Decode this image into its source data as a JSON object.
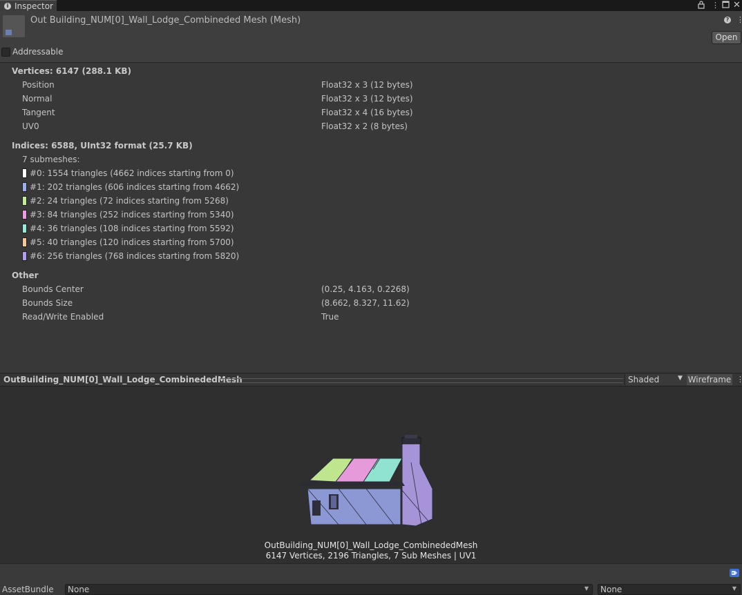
{
  "tab": {
    "label": "Inspector"
  },
  "header": {
    "title": "Out Building_NUM[0]_Wall_Lodge_Combineded Mesh (Mesh)",
    "open_label": "Open",
    "addressable_label": "Addressable",
    "addressable_checked": false
  },
  "vertices": {
    "heading": "Vertices: 6147 (288.1 KB)",
    "attributes": [
      {
        "name": "Position",
        "format": "Float32 x 3 (12 bytes)"
      },
      {
        "name": "Normal",
        "format": "Float32 x 3 (12 bytes)"
      },
      {
        "name": "Tangent",
        "format": "Float32 x 4 (16 bytes)"
      },
      {
        "name": "UV0",
        "format": "Float32 x 2 (8 bytes)"
      }
    ]
  },
  "indices": {
    "heading": "Indices: 6588, UInt32 format (25.7 KB)",
    "submesh_count_label": "7 submeshes:",
    "submeshes": [
      {
        "label": "#0: 1554 triangles (4662 indices starting from 0)",
        "color": "#ffffff"
      },
      {
        "label": "#1: 202 triangles (606 indices starting from 4662)",
        "color": "#9db0ea"
      },
      {
        "label": "#2: 24 triangles (72 indices starting from 5268)",
        "color": "#c3eb96"
      },
      {
        "label": "#3: 84 triangles (252 indices starting from 5340)",
        "color": "#ec9ce0"
      },
      {
        "label": "#4: 36 triangles (108 indices starting from 5592)",
        "color": "#96ecdc"
      },
      {
        "label": "#5: 40 triangles (120 indices starting from 5700)",
        "color": "#f5c99c"
      },
      {
        "label": "#6: 256 triangles (768 indices starting from 5820)",
        "color": "#b39ced"
      }
    ]
  },
  "other": {
    "heading": "Other",
    "rows": [
      {
        "name": "Bounds Center",
        "value": "(0.25, 4.163, 0.2268)"
      },
      {
        "name": "Bounds Size",
        "value": "(8.662, 8.327, 11.62)"
      },
      {
        "name": "Read/Write Enabled",
        "value": "True"
      }
    ]
  },
  "preview": {
    "title": "OutBuilding_NUM[0]_Wall_Lodge_CombinededMesh",
    "shading_mode": "Shaded",
    "wireframe_label": "Wireframe",
    "mesh_name": "OutBuilding_NUM[0]_Wall_Lodge_CombinededMesh",
    "mesh_stats": "6147 Vertices, 2196 Triangles, 7 Sub Meshes | UV1"
  },
  "footer": {
    "assetbundle_label": "AssetBundle",
    "bundle_value": "None",
    "variant_value": "None"
  }
}
